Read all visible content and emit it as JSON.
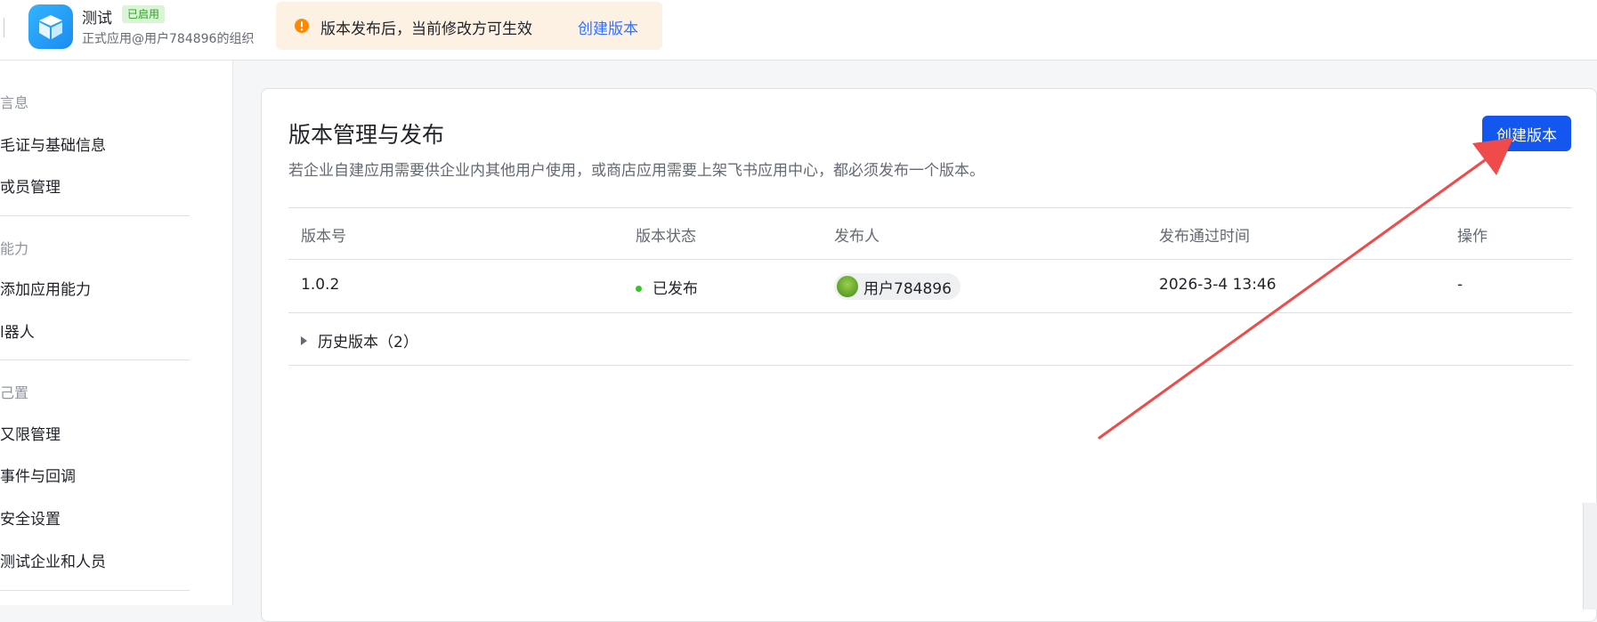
{
  "header": {
    "app_name": "测试",
    "status_badge": "已启用",
    "app_subtitle": "正式应用@用户784896的组织",
    "app_icon": "cube-icon",
    "notice": {
      "text": "版本发布后，当前修改方可生效",
      "link": "创建版本",
      "icon": "warning-icon",
      "color": "#ff8800"
    }
  },
  "sidebar": {
    "groups": [
      {
        "label": "信息",
        "display": "言息",
        "items": [
          {
            "label": "凭证与基础信息",
            "display": "毛证与基础信息"
          },
          {
            "label": "成员管理",
            "display": "戓员管理"
          }
        ]
      },
      {
        "label": "能力",
        "display": "能力",
        "items": [
          {
            "label": "添加应用能力",
            "display": "添加应用能力"
          },
          {
            "label": "机器人",
            "display": "l器人"
          }
        ]
      },
      {
        "label": "配置",
        "display": "己置",
        "items": [
          {
            "label": "权限管理",
            "display": "又限管理"
          },
          {
            "label": "事件与回调",
            "display": "事件与回调"
          },
          {
            "label": "安全设置",
            "display": "安全设置"
          },
          {
            "label": "测试企业和人员",
            "display": "测试企业和人员"
          }
        ]
      }
    ]
  },
  "main": {
    "title": "版本管理与发布",
    "description": "若企业自建应用需要供企业内其他用户使用，或商店应用需要上架飞书应用中心，都必须发布一个版本。",
    "create_button": "创建版本",
    "table": {
      "headers": [
        "版本号",
        "版本状态",
        "发布人",
        "发布通过时间",
        "操作"
      ],
      "rows": [
        {
          "version": "1.0.2",
          "status": "已发布",
          "publisher": "用户784896",
          "time": "2026-3-4 13:46",
          "action": "-"
        }
      ]
    },
    "history_label": "历史版本（2）"
  },
  "colors": {
    "primary": "#1456f0",
    "link": "#3370ff",
    "success": "#34c724",
    "annotation_arrow": "#f04a4a"
  }
}
